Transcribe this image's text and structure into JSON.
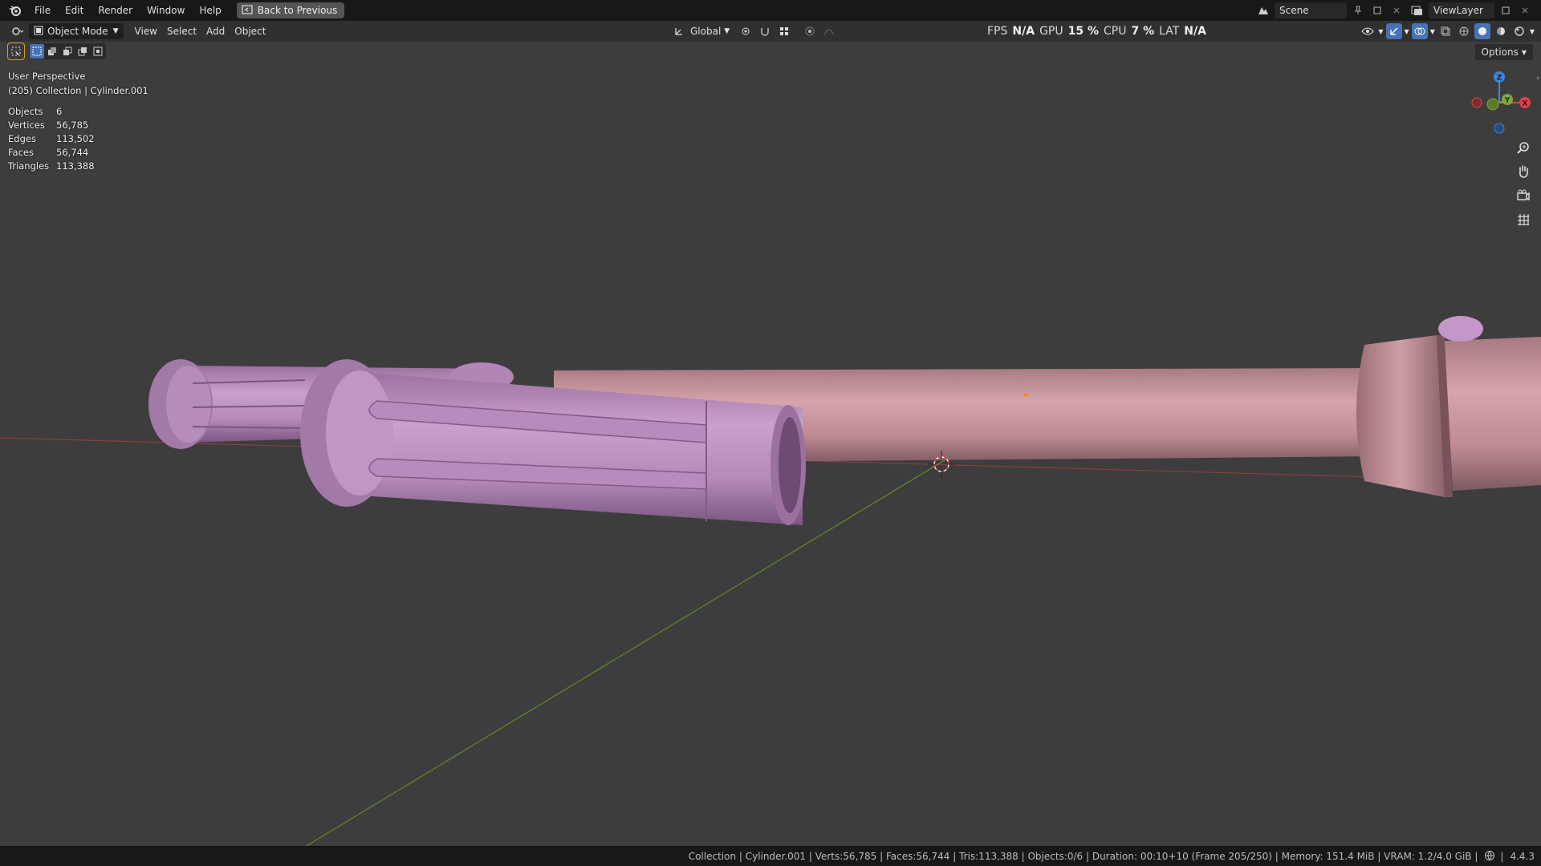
{
  "app": {
    "menu": [
      "File",
      "Edit",
      "Render",
      "Window",
      "Help"
    ],
    "back_button": "Back to Previous"
  },
  "scene": {
    "label": "Scene"
  },
  "view_layer": {
    "label": "ViewLayer"
  },
  "header": {
    "mode": "Object Mode",
    "menus": [
      "View",
      "Select",
      "Add",
      "Object"
    ],
    "transform_orientation": "Global"
  },
  "perf": {
    "fps_label": "FPS",
    "fps_value": "N/A",
    "gpu_label": "GPU",
    "gpu_value": "15 %",
    "cpu_label": "CPU",
    "cpu_value": "7 %",
    "lat_label": "LAT",
    "lat_value": "N/A"
  },
  "options_label": "Options",
  "viewport": {
    "perspective": "User Perspective",
    "collection_line": "(205) Collection | Cylinder.001",
    "stats": [
      {
        "k": "Objects",
        "v": "6"
      },
      {
        "k": "Vertices",
        "v": "56,785"
      },
      {
        "k": "Edges",
        "v": "113,502"
      },
      {
        "k": "Faces",
        "v": "56,744"
      },
      {
        "k": "Triangles",
        "v": "113,388"
      }
    ]
  },
  "gizmo": {
    "z": "Z",
    "y": "Y",
    "x": "X"
  },
  "colors": {
    "accent": "#4772b3",
    "axis_x": "#e0404a",
    "axis_y": "#7ea83a",
    "axis_z": "#3f85d6",
    "mesh_pink": "#c49098",
    "mesh_purple": "#b48ab8"
  },
  "statusbar": {
    "text": "Collection | Cylinder.001 | Verts:56,785 | Faces:56,744 | Tris:113,388 | Objects:0/6 | Duration: 00:10+10 (Frame 205/250) | Memory: 151.4 MiB | VRAM: 1.2/4.0 GiB |",
    "version": "4.4.3"
  }
}
